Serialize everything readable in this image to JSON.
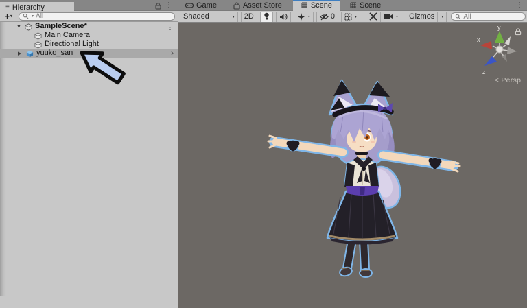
{
  "glyphs": {
    "hamburger": "≡",
    "kebab": "⋮",
    "foldout_open": "▼",
    "foldout_closed": "▶",
    "dropdown": "▾",
    "chevron": "›",
    "plus": "+",
    "angle_left": "<"
  },
  "hierarchy": {
    "tab_label": "Hierarchy",
    "search_placeholder": "All",
    "rows": [
      {
        "label": "SampleScene*",
        "type": "scene",
        "selected": false
      },
      {
        "label": "Main Camera",
        "type": "gameobject",
        "selected": false
      },
      {
        "label": "Directional Light",
        "type": "gameobject",
        "selected": false
      },
      {
        "label": "yuuko_san",
        "type": "prefab",
        "selected": true
      }
    ]
  },
  "scene_panel": {
    "tabs": [
      {
        "label": "Game",
        "active": false
      },
      {
        "label": "Asset Store",
        "active": false
      },
      {
        "label": "Scene",
        "active": true
      },
      {
        "label": "Scene",
        "active": false
      }
    ],
    "toolbar": {
      "shading_mode": "Shaded",
      "toggle_2d": "2D",
      "visibility_count": "0",
      "gizmos_label": "Gizmos",
      "search_placeholder": "All"
    },
    "viewport": {
      "persp_label": "Persp",
      "axis_x": "x",
      "axis_y": "y",
      "axis_z": "z"
    }
  },
  "colors": {
    "accent_blue": "#3f7fc1",
    "selection_outline": "#7fb6e8",
    "viewport_bg": "#6c6864",
    "panel_bg": "#c8c8c8",
    "selected_row": "#a9a9a9",
    "annotation_arrow_fill": "#b9cdf0",
    "prefab_icon_blue": "#4a90cc",
    "axis_x_red": "#b8443a",
    "axis_y_green": "#72b043",
    "axis_z_blue": "#3a55c8"
  }
}
